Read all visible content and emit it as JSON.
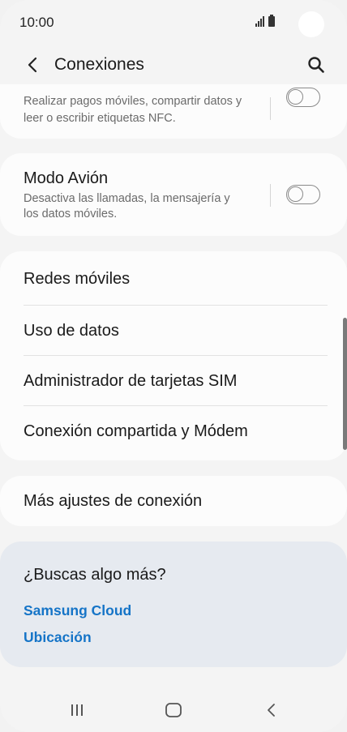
{
  "status_bar": {
    "time": "10:00"
  },
  "header": {
    "title": "Conexiones"
  },
  "nfc": {
    "subtitle_line1": "Realizar pagos móviles, compartir datos y",
    "subtitle_line2": "leer o escribir etiquetas NFC.",
    "toggle_on": false
  },
  "airplane": {
    "title": "Modo Avión",
    "subtitle_line1": "Desactiva las llamadas, la mensajería y",
    "subtitle_line2": "los datos móviles.",
    "toggle_on": false
  },
  "network_items": [
    {
      "label": "Redes móviles"
    },
    {
      "label": "Uso de datos"
    },
    {
      "label": "Administrador de tarjetas SIM"
    },
    {
      "label": "Conexión compartida y Módem"
    }
  ],
  "more_settings": {
    "label": "Más ajustes de conexión"
  },
  "suggestions": {
    "title": "¿Buscas algo más?",
    "links": [
      {
        "label": "Samsung Cloud"
      },
      {
        "label": "Ubicación"
      }
    ]
  },
  "colors": {
    "link": "#1574c7",
    "background": "#f4f4f4",
    "card": "#fcfcfc",
    "suggest_card": "#e6eaf0"
  },
  "icons": {
    "back": "chevron-left-icon",
    "search": "search-icon",
    "recents": "recents-icon",
    "home": "home-icon",
    "nav_back": "nav-back-icon"
  }
}
